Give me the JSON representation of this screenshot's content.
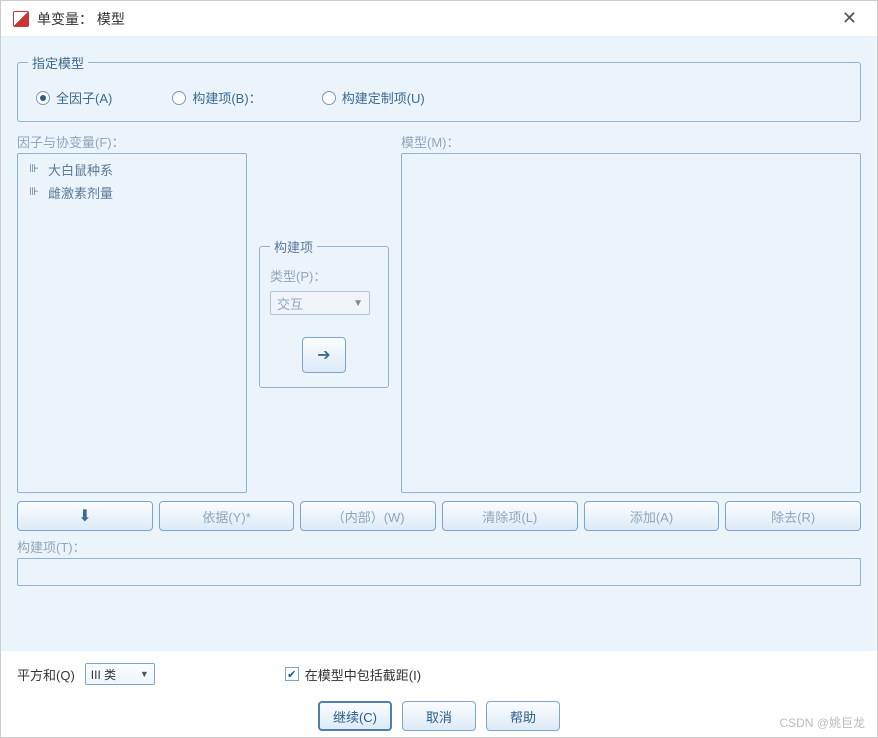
{
  "title": "单变量： 模型",
  "specify_model": {
    "legend": "指定模型",
    "full_factor": "全因子(A)",
    "build_terms": "构建项(B)：",
    "build_custom": "构建定制项(U)"
  },
  "factors": {
    "label": "因子与协变量(F)：",
    "items": [
      "大白鼠种系",
      "雌激素剂量"
    ]
  },
  "build_panel": {
    "legend": "构建项",
    "type_label": "类型(P)：",
    "type_value": "交互"
  },
  "model": {
    "label": "模型(M)："
  },
  "buttons": {
    "by": "依据(Y)*",
    "within": "（内部）(W)",
    "clear": "清除项(L)",
    "add": "添加(A)",
    "remove": "除去(R)"
  },
  "term_label": "构建项(T)：",
  "ss": {
    "label": "平方和(Q)",
    "value": "III 类"
  },
  "intercept": "在模型中包括截距(I)",
  "dlg": {
    "continue": "继续(C)",
    "cancel": "取消",
    "help": "帮助"
  },
  "watermark": "CSDN @姚巨龙"
}
